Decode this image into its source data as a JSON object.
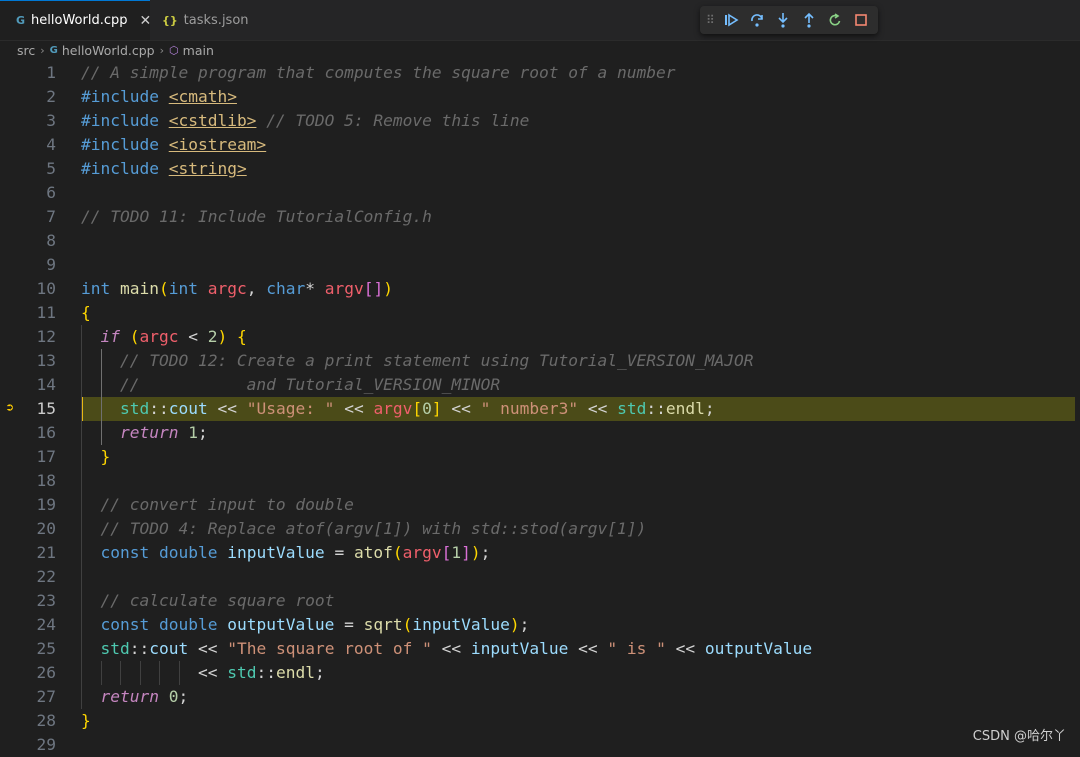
{
  "tabs": [
    {
      "label": "helloWorld.cpp",
      "icon": "C++",
      "active": true
    },
    {
      "label": "tasks.json",
      "icon": "{}",
      "active": false
    }
  ],
  "breadcrumb": [
    "src",
    "helloWorld.cpp",
    "main"
  ],
  "debug_toolbar": [
    "continue",
    "step-over",
    "step-into",
    "step-out",
    "restart",
    "stop"
  ],
  "current_line": 15,
  "lines": [
    "// A simple program that computes the square root of a number",
    "#include <cmath>",
    "#include <cstdlib> // TODO 5: Remove this line",
    "#include <iostream>",
    "#include <string>",
    "",
    "// TODO 11: Include TutorialConfig.h",
    "",
    "",
    "int main(int argc, char* argv[])",
    "{",
    "  if (argc < 2) {",
    "    // TODO 12: Create a print statement using Tutorial_VERSION_MAJOR",
    "    //           and Tutorial_VERSION_MINOR",
    "    std::cout << \"Usage: \" << argv[0] << \" number3\" << std::endl;",
    "    return 1;",
    "  }",
    "",
    "  // convert input to double",
    "  // TODO 4: Replace atof(argv[1]) with std::stod(argv[1])",
    "  const double inputValue = atof(argv[1]);",
    "",
    "  // calculate square root",
    "  const double outputValue = sqrt(inputValue);",
    "  std::cout << \"The square root of \" << inputValue << \" is \" << outputValue",
    "            << std::endl;",
    "  return 0;",
    "}",
    ""
  ],
  "watermark": "CSDN @哈尔丫",
  "colors": {
    "accent": "#0078d4",
    "current_line_bg": "#4b4b18",
    "breakpoint_arrow": "#ffcc00"
  }
}
